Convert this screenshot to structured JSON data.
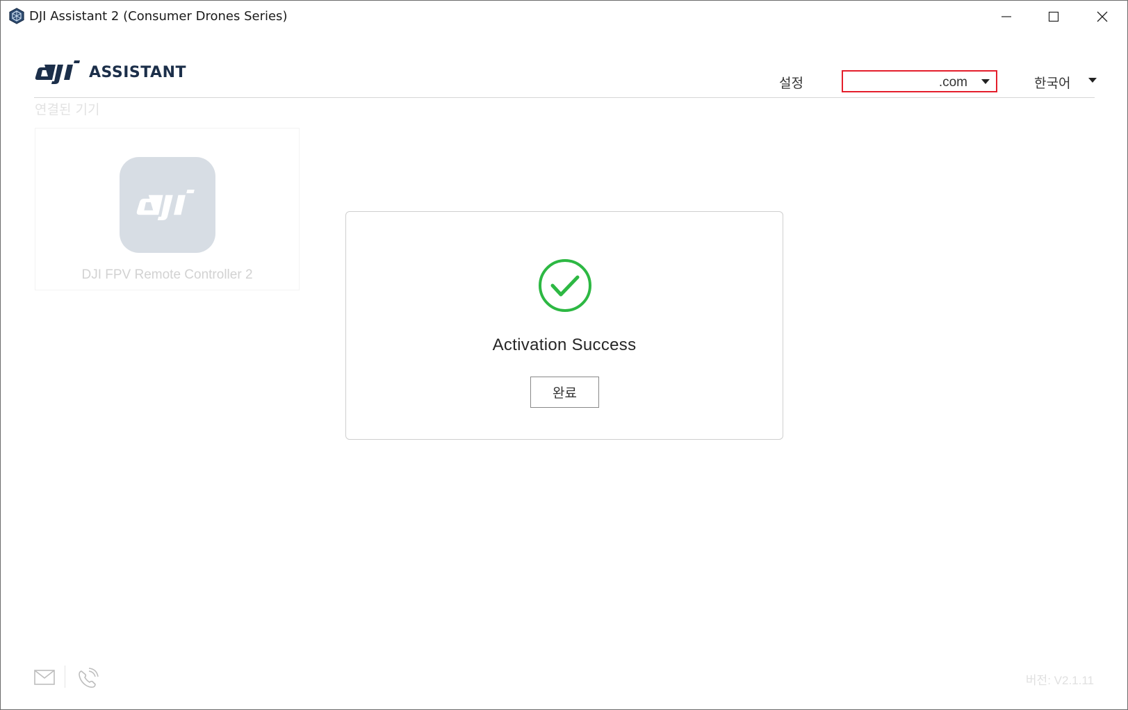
{
  "window": {
    "title": "DJI Assistant 2 (Consumer Drones Series)"
  },
  "header": {
    "logo_text": "ASSISTANT",
    "settings_label": "설정",
    "region_value": ".com",
    "language_value": "한국어"
  },
  "sidebar": {
    "section_label": "연결된 기기",
    "devices": [
      {
        "name": "DJI FPV Remote Controller 2"
      }
    ]
  },
  "modal": {
    "message": "Activation Success",
    "done_label": "완료"
  },
  "footer": {
    "version": "버전: V2.1.11"
  },
  "colors": {
    "success": "#2db843",
    "highlight_border": "#e41e2b",
    "brand_navy": "#1c2f4a"
  }
}
